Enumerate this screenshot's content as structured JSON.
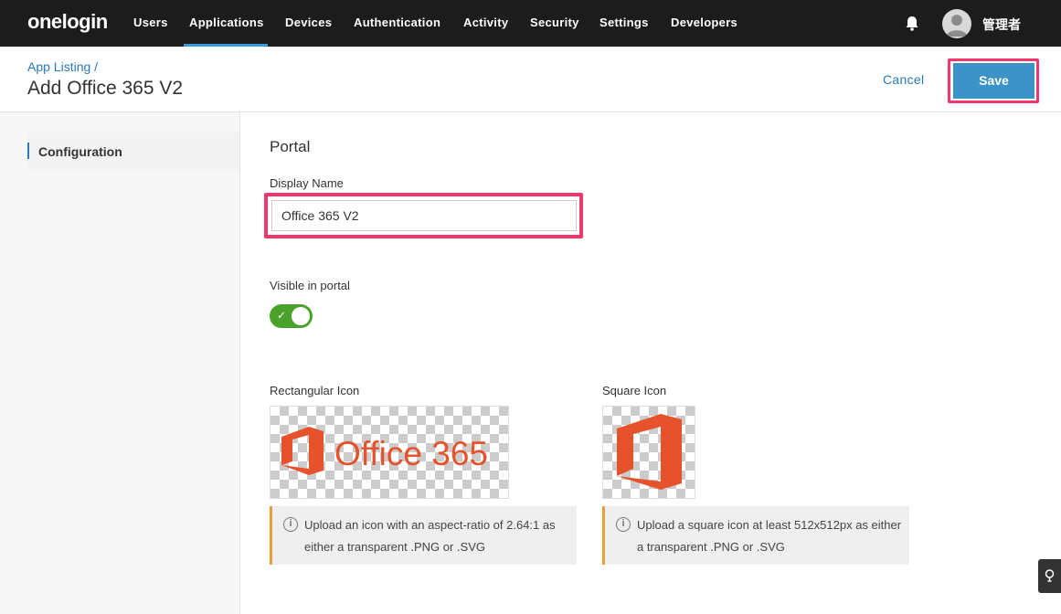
{
  "brand": {
    "logo_text": "onelogin"
  },
  "nav": {
    "items": [
      {
        "label": "Users"
      },
      {
        "label": "Applications"
      },
      {
        "label": "Devices"
      },
      {
        "label": "Authentication"
      },
      {
        "label": "Activity"
      },
      {
        "label": "Security"
      },
      {
        "label": "Settings"
      },
      {
        "label": "Developers"
      }
    ],
    "active": "Applications",
    "user_name": "管理者"
  },
  "header": {
    "breadcrumb": "App Listing /",
    "title": "Add Office 365 V2",
    "cancel_label": "Cancel",
    "save_label": "Save"
  },
  "sidebar": {
    "items": [
      {
        "label": "Configuration"
      }
    ]
  },
  "portal": {
    "section_title": "Portal",
    "display_name_label": "Display Name",
    "display_name_value": "Office 365 V2",
    "visible_label": "Visible in portal",
    "visible_on": true,
    "rect_icon_label": "Rectangular Icon",
    "square_icon_label": "Square Icon",
    "rect_icon_image_text": "Office 365",
    "rect_info": "Upload an icon with an aspect-ratio of 2.64:1 as either a transparent .PNG or .SVG",
    "square_info": "Upload a square icon at least 512x512px as either a transparent .PNG or .SVG"
  },
  "colors": {
    "nav_bg": "#1c1c1c",
    "accent_blue": "#3b93c8",
    "highlight_pink": "#f2376f",
    "toggle_green": "#4aa22a",
    "office_orange": "#e6522c"
  }
}
